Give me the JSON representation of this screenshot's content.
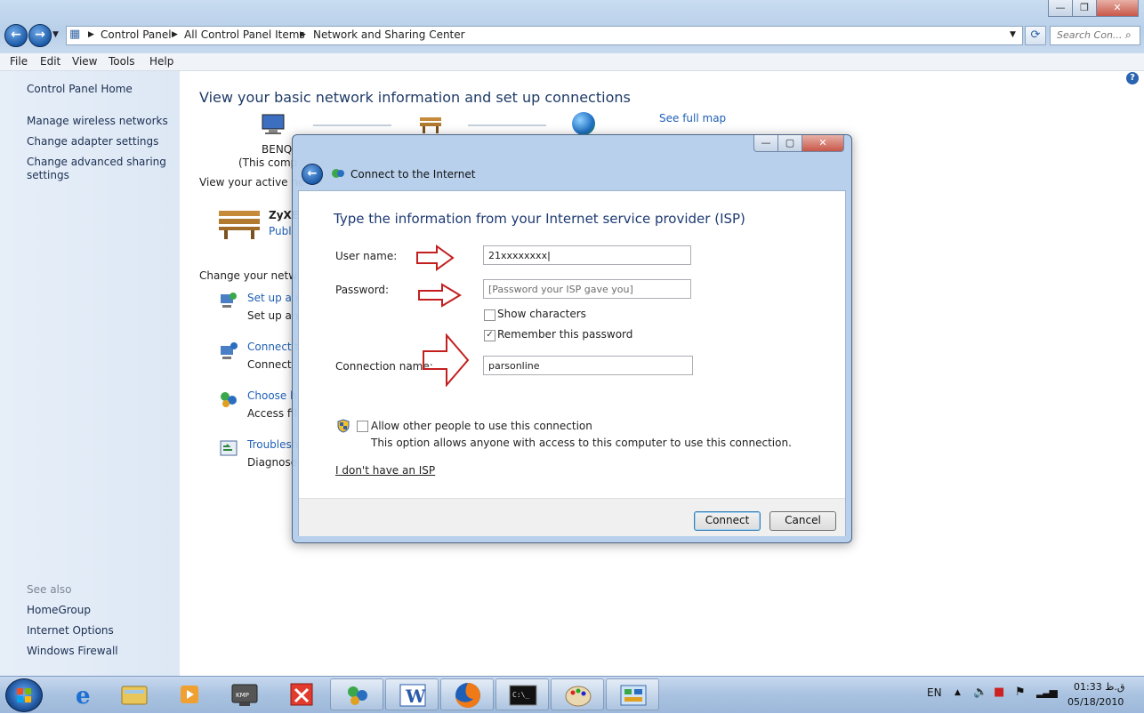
{
  "addressbar": {
    "crumbs": [
      "Control Panel",
      "All Control Panel Items",
      "Network and Sharing Center"
    ],
    "search_placeholder": "Search Con..."
  },
  "menu": [
    "File",
    "Edit",
    "View",
    "Tools",
    "Help"
  ],
  "sidebar": {
    "home": "Control Panel Home",
    "links": [
      "Manage wireless networks",
      "Change adapter settings",
      "Change advanced sharing",
      "settings"
    ],
    "see_also_label": "See also",
    "see_also": [
      "HomeGroup",
      "Internet Options",
      "Windows Firewall"
    ]
  },
  "main": {
    "title": "View your basic network information and set up connections",
    "see_full_map": "See full map",
    "computer_name": "BENQ",
    "computer_sub": "(This comp",
    "active_networks": "View your active ne",
    "network_name": "ZyXE",
    "network_type": "Publ",
    "change_settings": "Change your netwo",
    "tasks": [
      {
        "title": "Set up a n",
        "desc": "Set up a w"
      },
      {
        "title": "Connect t",
        "desc": "Connect"
      },
      {
        "title": "Choose h",
        "desc": "Access fil"
      },
      {
        "title": "Troublesh",
        "desc": "Diagnose"
      }
    ]
  },
  "dialog": {
    "title": "Connect to the Internet",
    "heading": "Type the information from your Internet service provider (ISP)",
    "username_label": "User name:",
    "username_value": "21xxxxxxxx",
    "password_label": "Password:",
    "password_placeholder": "[Password your ISP gave you]",
    "show_characters": "Show characters",
    "remember_password": "Remember this password",
    "connection_name_label": "Connection name:",
    "connection_name_value": "parsonline",
    "allow_others": "Allow other people to use this connection",
    "allow_others_desc": "This option allows anyone with access to this computer to use this connection.",
    "no_isp_link": "I don't have an ISP",
    "connect_button": "Connect",
    "cancel_button": "Cancel",
    "show_characters_checked": false,
    "remember_password_checked": true,
    "allow_others_checked": false
  },
  "taskbar": {
    "lang": "EN",
    "time": "01:33 ق.ظ",
    "date": "05/18/2010"
  },
  "colors": {
    "link": "#1f5fb6",
    "arrow": "#c41f1f"
  }
}
